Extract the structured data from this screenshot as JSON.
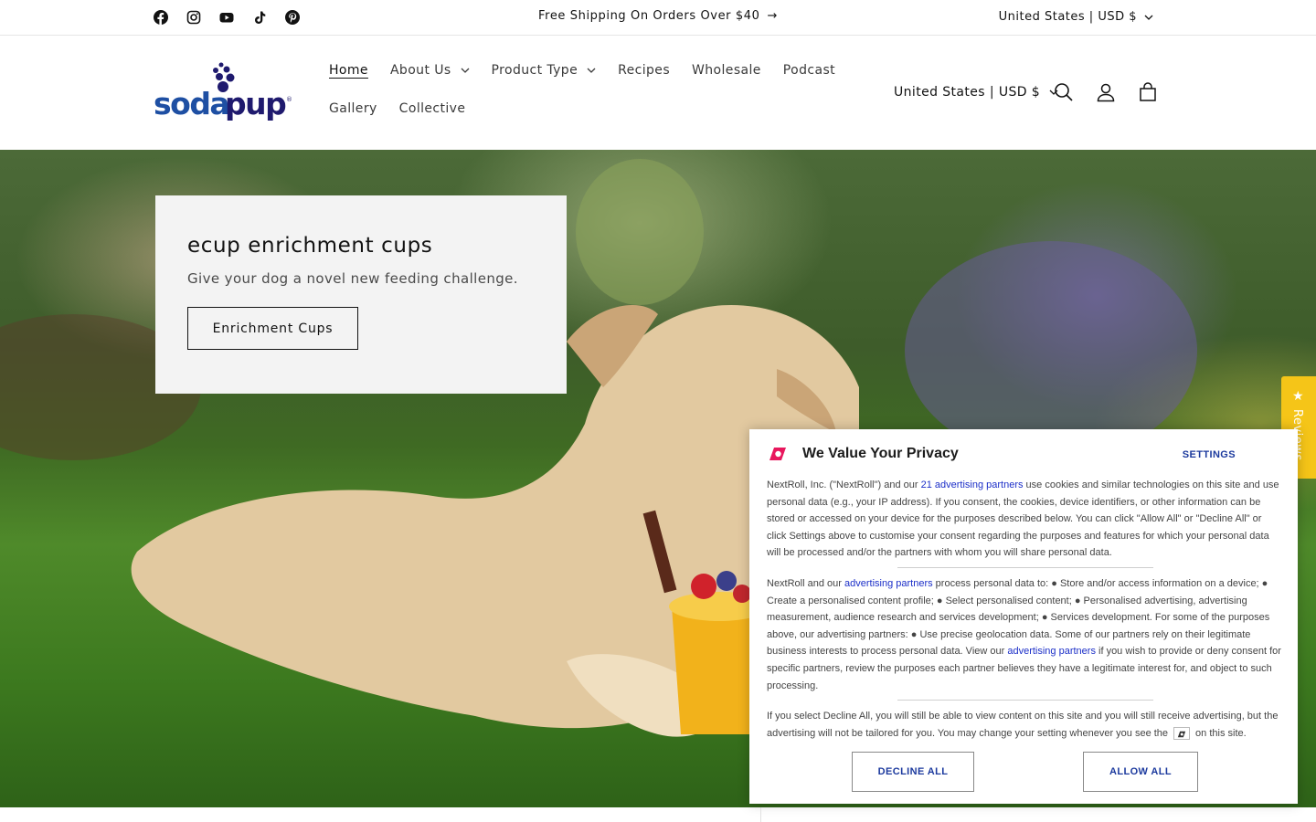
{
  "announcement": {
    "text": "Free Shipping On Orders Over $40",
    "locale": "United States | USD $",
    "social": [
      "facebook-icon",
      "instagram-icon",
      "youtube-icon",
      "tiktok-icon",
      "pinterest-icon"
    ]
  },
  "header": {
    "logo_text": "sodapup",
    "nav": [
      {
        "label": "Home",
        "active": true,
        "dropdown": false
      },
      {
        "label": "About Us",
        "dropdown": true
      },
      {
        "label": "Product Type",
        "dropdown": true
      },
      {
        "label": "Recipes",
        "dropdown": false
      },
      {
        "label": "Wholesale",
        "dropdown": false
      },
      {
        "label": "Podcast",
        "dropdown": false
      },
      {
        "label": "Gallery",
        "dropdown": false
      },
      {
        "label": "Collective",
        "dropdown": false
      }
    ],
    "locale": "United States | USD $",
    "icons": [
      "search-icon",
      "account-icon",
      "cart-icon"
    ]
  },
  "hero": {
    "title": "ecup enrichment cups",
    "subtitle": "Give your dog a novel new feeding challenge.",
    "button": "Enrichment Cups"
  },
  "reviews_tab": {
    "star": "★",
    "label": "Reviews"
  },
  "consent": {
    "title": "We Value Your Privacy",
    "settings": "SETTINGS",
    "p1_a": "NextRoll, Inc. (\"NextRoll\") and our ",
    "p1_link": "21 advertising partners",
    "p1_b": " use cookies and similar technologies on this site and use personal data (e.g., your IP address). If you consent, the cookies, device identifiers, or other information can be stored or accessed on your device for the purposes described below. You can click \"Allow All\" or \"Decline All\" or click Settings above to customise your consent regarding the purposes and features for which your personal data will be processed and/or the partners with whom you will share personal data.",
    "p2_a": "NextRoll and our ",
    "p2_link1": "advertising partners",
    "p2_b": " process personal data to: ● Store and/or access information on a device; ● Create a personalised content profile; ● Select personalised content; ● Personalised advertising, advertising measurement, audience research and services development; ● Services development. For some of the purposes above, our advertising partners: ● Use precise geolocation data. Some of our partners rely on their legitimate business interests to process personal data. View our ",
    "p2_link2": "advertising partners",
    "p2_c": " if you wish to provide or deny consent for specific partners, review the purposes each partner believes they have a legitimate interest for, and object to such processing.",
    "p3_a": "If you select Decline All, you will still be able to view content on this site and you will still receive advertising, but the advertising will not be tailored for you. You may change your setting whenever you see the",
    "p3_b": "on this site.",
    "decline": "DECLINE ALL",
    "allow": "ALLOW ALL",
    "brand_color": "#e8175d"
  }
}
